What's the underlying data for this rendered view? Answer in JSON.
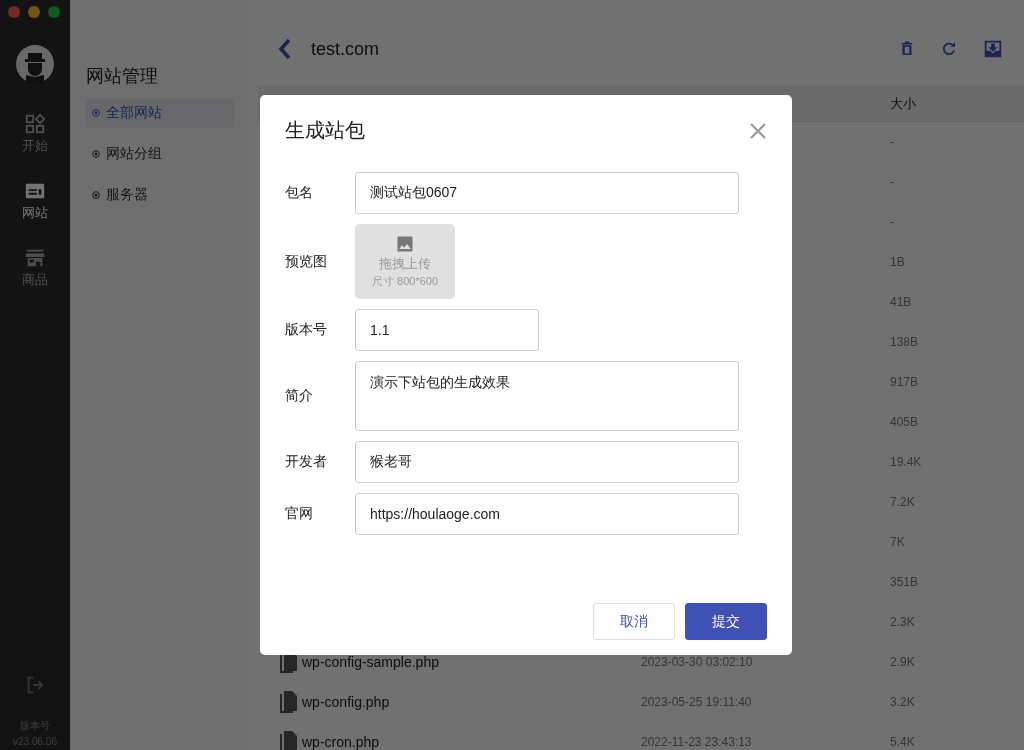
{
  "nav": {
    "items": [
      {
        "label": "开始",
        "selected": false
      },
      {
        "label": "网站",
        "selected": true
      },
      {
        "label": "商品",
        "selected": false
      }
    ],
    "version_label": "版本号",
    "version": "v23.06.06"
  },
  "section": {
    "title": "网站管理",
    "items": [
      {
        "label": "全部网站",
        "selected": true
      },
      {
        "label": "网站分组",
        "selected": false
      },
      {
        "label": "服务器",
        "selected": false
      }
    ]
  },
  "header": {
    "title": "test.com"
  },
  "table": {
    "columns": [
      {
        "label": "大小"
      }
    ],
    "rows": [
      {
        "size": "-"
      },
      {
        "size": "-"
      },
      {
        "size": "-"
      },
      {
        "size": "1B"
      },
      {
        "size": "41B"
      },
      {
        "size": "138B"
      },
      {
        "size": "917B"
      },
      {
        "size": "405B"
      },
      {
        "size": "19.4K"
      },
      {
        "size": "7.2K"
      },
      {
        "size": "7K"
      },
      {
        "size": "351B"
      },
      {
        "size": "2.3K"
      },
      {
        "name": "wp-config-sample.php",
        "date": "2023-03-30 03:02:10",
        "size": "2.9K"
      },
      {
        "name": "wp-config.php",
        "date": "2023-05-25 19:11:40",
        "size": "3.2K"
      },
      {
        "name": "wp-cron.php",
        "date": "2022-11-23 23:43:13",
        "size": "5.4K"
      }
    ]
  },
  "dialog": {
    "title": "生成站包",
    "fields": [
      {
        "kind": "text",
        "label": "包名",
        "value": "测试站包0607"
      },
      {
        "kind": "upload",
        "label": "预览图",
        "hint": "拖拽上传",
        "size_hint": "尺寸 800*600"
      },
      {
        "kind": "short",
        "label": "版本号",
        "value": "1.1"
      },
      {
        "kind": "textarea",
        "label": "简介",
        "value": "演示下站包的生成效果"
      },
      {
        "kind": "text",
        "label": "开发者",
        "value": "猴老哥"
      },
      {
        "kind": "text",
        "label": "官网",
        "value": "https://houlaoge.com"
      }
    ],
    "buttons": [
      {
        "kind": "secondary",
        "label": "取消"
      },
      {
        "kind": "primary",
        "label": "提交"
      }
    ]
  }
}
